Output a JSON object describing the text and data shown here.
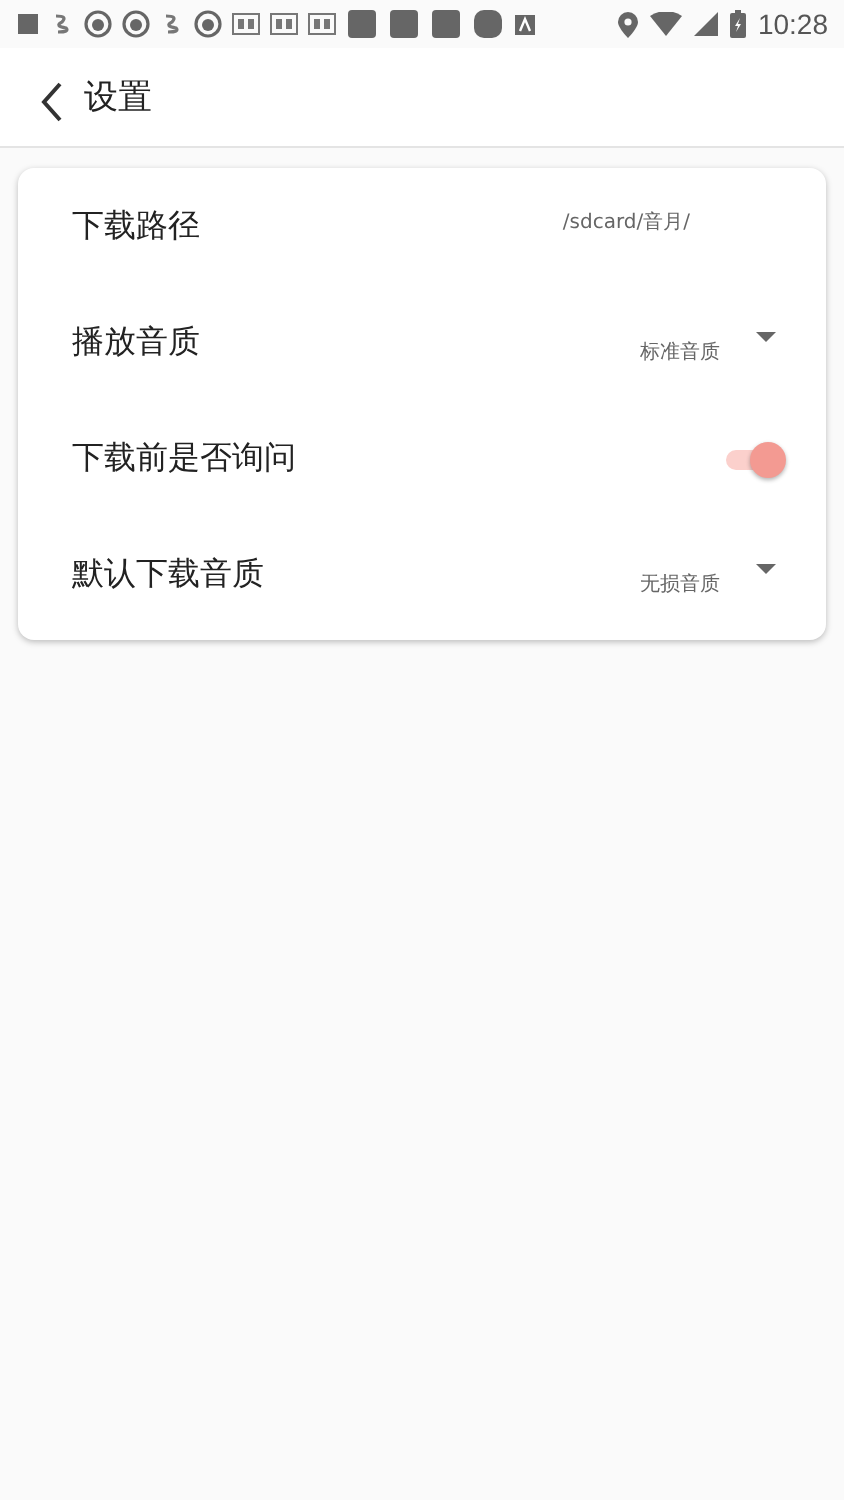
{
  "status_bar": {
    "time": "10:28"
  },
  "header": {
    "title": "设置"
  },
  "settings": [
    {
      "kind": "text",
      "label": "下载路径",
      "value": "/sdcard/音月/"
    },
    {
      "kind": "dropdown",
      "label": "播放音质",
      "value": "标准音质"
    },
    {
      "kind": "switch",
      "label": "下载前是否询问",
      "on": true
    },
    {
      "kind": "dropdown",
      "label": "默认下载音质",
      "value": "无损音质"
    }
  ]
}
